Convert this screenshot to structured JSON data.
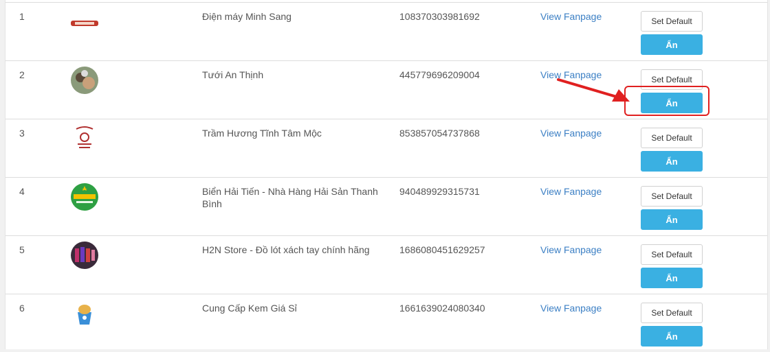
{
  "rows": [
    {
      "index": "1",
      "name": "Điện máy Minh Sang",
      "page_id": "108370303981692",
      "link": "View Fanpage",
      "set_default": "Set Default",
      "hide": "Ẩn",
      "logo": "minh-sang-logo"
    },
    {
      "index": "2",
      "name": "Tưới An Thịnh",
      "page_id": "445779696209004",
      "link": "View Fanpage",
      "set_default": "Set Default",
      "hide": "Ẩn",
      "logo": "an-thinh-avatar"
    },
    {
      "index": "3",
      "name": "Trầm Hương Tĩnh Tâm Mộc",
      "page_id": "853857054737868",
      "link": "View Fanpage",
      "set_default": "Set Default",
      "hide": "Ẩn",
      "logo": "tram-huong-logo"
    },
    {
      "index": "4",
      "name": "Biển Hải Tiến - Nhà Hàng Hải Sản Thanh Bình",
      "page_id": "940489929315731",
      "link": "View Fanpage",
      "set_default": "Set Default",
      "hide": "Ẩn",
      "logo": "thanh-binh-logo"
    },
    {
      "index": "5",
      "name": "H2N Store - Đồ lót xách tay chính hãng",
      "page_id": "1686080451629257",
      "link": "View Fanpage",
      "set_default": "Set Default",
      "hide": "Ẩn",
      "logo": "h2n-store-avatar"
    },
    {
      "index": "6",
      "name": "Cung Cấp Kem Giá Sỉ",
      "page_id": "1661639024080340",
      "link": "View Fanpage",
      "set_default": "Set Default",
      "hide": "Ẩn",
      "logo": "ice-cream-avatar"
    }
  ],
  "annotation": {
    "highlight_color": "#e02020",
    "target": "row-2-hide-button"
  }
}
